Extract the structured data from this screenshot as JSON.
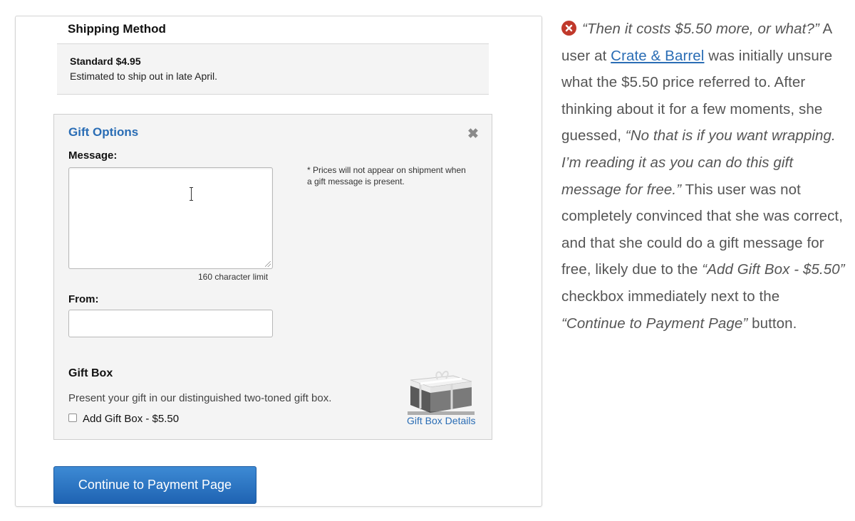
{
  "shipping": {
    "title": "Shipping Method",
    "option_name": "Standard $4.95",
    "estimate": "Estimated to ship out in late April."
  },
  "gift_options": {
    "title": "Gift Options",
    "message_label": "Message:",
    "message_value": "",
    "char_limit": "160 character limit",
    "prices_note": "* Prices will not appear on shipment when a gift message is present.",
    "from_label": "From:",
    "from_value": "",
    "gift_box": {
      "title": "Gift Box",
      "description": "Present your gift in our distinguished two-toned gift box.",
      "checkbox_label": "Add Gift Box - $5.50",
      "checked": false,
      "details_link": "Gift Box Details"
    }
  },
  "continue_button": "Continue to Payment Page",
  "commentary": {
    "quote1": "“Then it costs $5.50 more, or what?”",
    "text1": " A user at ",
    "link": "Crate & Barrel",
    "text2": " was initially unsure what the $5.50 price referred to. After thinking about it for a few moments, she guessed, ",
    "quote2": "“No that is if you want wrapping. I’m reading it as you can do this gift message for free.”",
    "text3": " This user was not completely convinced that she was correct, and that she could do a gift message for free, likely due to the ",
    "quote3": "“Add Gift Box - $5.50”",
    "text4": " checkbox immediately next to the ",
    "quote4": "“Continue to Payment Page”",
    "text5": " button."
  },
  "colors": {
    "accent": "#2a6db5",
    "button": "#1f63b2",
    "error": "#c0392b"
  }
}
